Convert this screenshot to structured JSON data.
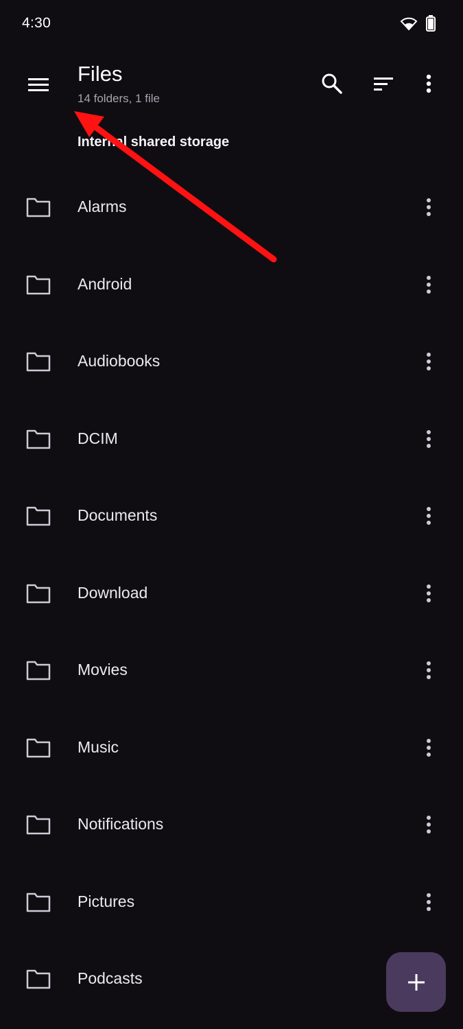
{
  "status_bar": {
    "time": "4:30",
    "icons": [
      "wifi-icon",
      "battery-icon"
    ]
  },
  "app_bar": {
    "title": "Files",
    "subtitle": "14 folders, 1 file",
    "icons": [
      "menu-icon",
      "search-icon",
      "sort-icon",
      "more-vert-icon"
    ]
  },
  "section": {
    "label": "Internal shared storage"
  },
  "files": [
    {
      "name": "Alarms",
      "icon": "folder-icon"
    },
    {
      "name": "Android",
      "icon": "folder-icon"
    },
    {
      "name": "Audiobooks",
      "icon": "folder-icon"
    },
    {
      "name": "DCIM",
      "icon": "folder-icon"
    },
    {
      "name": "Documents",
      "icon": "folder-icon"
    },
    {
      "name": "Download",
      "icon": "folder-icon"
    },
    {
      "name": "Movies",
      "icon": "folder-icon"
    },
    {
      "name": "Music",
      "icon": "folder-icon"
    },
    {
      "name": "Notifications",
      "icon": "folder-icon"
    },
    {
      "name": "Pictures",
      "icon": "folder-icon"
    },
    {
      "name": "Podcasts",
      "icon": "folder-icon"
    }
  ],
  "fab": {
    "icon": "plus-icon"
  },
  "colors": {
    "background": "#0f0d12",
    "fab": "#4a3b5e",
    "annotation_arrow": "#ff1212"
  }
}
